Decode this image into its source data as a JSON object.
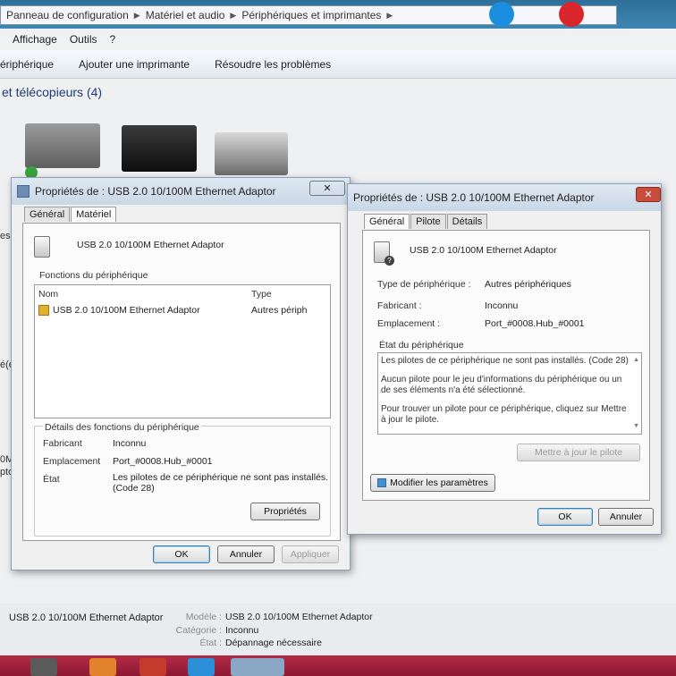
{
  "explorer": {
    "breadcrumbs": [
      "Panneau de configuration",
      "Matériel et audio",
      "Périphériques et imprimantes"
    ],
    "menu": [
      "Affichage",
      "Outils",
      "?"
    ],
    "commands": [
      "ériphérique",
      "Ajouter une imprimante",
      "Résoudre les problèmes"
    ],
    "section_title": "et télécopieurs (4)",
    "left_fragments": [
      "es",
      "é(e",
      "0M",
      "ptor"
    ],
    "bottom": {
      "device_name": "USB 2.0 10/100M Ethernet Adaptor",
      "model_label": "Modèle :",
      "model_value": "USB 2.0 10/100M Ethernet Adaptor",
      "category_label": "Catégorie :",
      "category_value": "Inconnu",
      "state_label": "État :",
      "state_value": "Dépannage nécessaire"
    }
  },
  "dialog_left": {
    "title": "Propriétés de : USB 2.0 10/100M Ethernet Adaptor",
    "close": "✕",
    "tabs": [
      "Général",
      "Matériel"
    ],
    "device_name": "USB 2.0 10/100M Ethernet Adaptor",
    "functions_label": "Fonctions du périphérique",
    "col_name": "Nom",
    "col_type": "Type",
    "row_name": "USB 2.0 10/100M Ethernet Adaptor",
    "row_type": "Autres périph",
    "details_title": "Détails des fonctions du périphérique",
    "manufacturer_label": "Fabricant",
    "manufacturer_value": "Inconnu",
    "location_label": "Emplacement",
    "location_value": "Port_#0008.Hub_#0001",
    "state_label": "État",
    "state_value_line1": "Les pilotes de ce périphérique ne sont pas installés.",
    "state_value_line2": "(Code 28)",
    "properties_button": "Propriétés",
    "ok": "OK",
    "cancel": "Annuler",
    "apply": "Appliquer"
  },
  "dialog_right": {
    "title": "Propriétés de : USB 2.0 10/100M Ethernet Adaptor",
    "tabs": [
      "Général",
      "Pilote",
      "Détails"
    ],
    "device_name": "USB 2.0 10/100M Ethernet Adaptor",
    "type_label": "Type de périphérique :",
    "type_value": "Autres périphériques",
    "manufacturer_label": "Fabricant :",
    "manufacturer_value": "Inconnu",
    "location_label": "Emplacement :",
    "location_value": "Port_#0008.Hub_#0001",
    "status_label": "État du périphérique",
    "status_p1": "Les pilotes de ce périphérique ne sont pas installés. (Code 28)",
    "status_p2": "Aucun pilote pour le jeu d'informations du périphérique ou un de ses éléments n'a été sélectionné.",
    "status_p3": "Pour trouver un pilote pour ce périphérique, cliquez sur Mettre à jour le pilote.",
    "update_button": "Mettre à jour le pilote",
    "modify_button": "Modifier les paramètres",
    "ok": "OK",
    "cancel": "Annuler"
  },
  "colors": {
    "taskbar": "#a3223e",
    "title_blue": "#1c3c78"
  }
}
